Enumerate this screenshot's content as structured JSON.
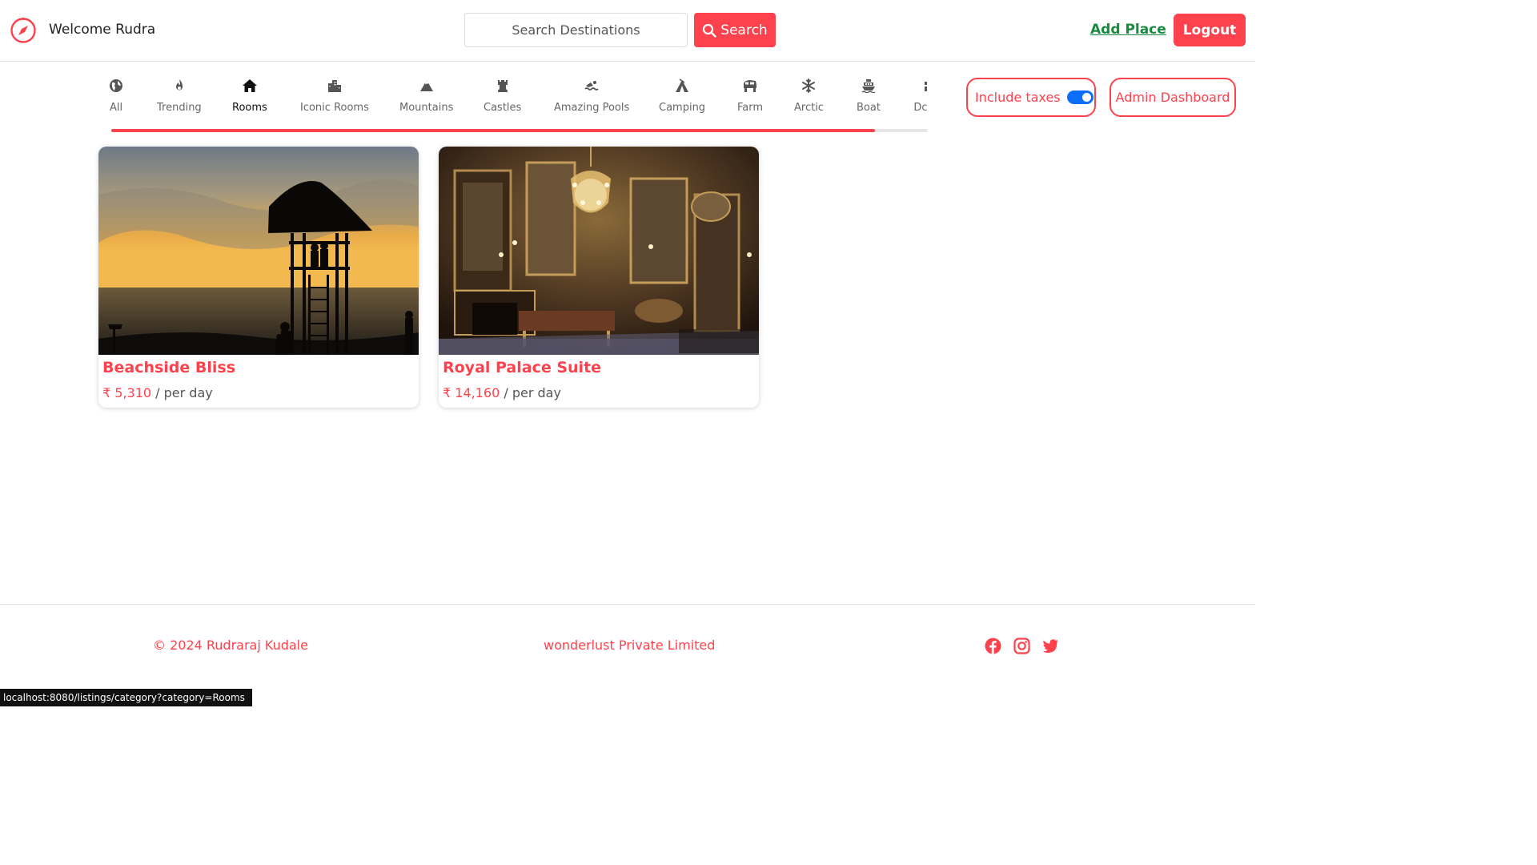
{
  "navbar": {
    "welcome": "Welcome Rudra",
    "search_placeholder": "Search Destinations",
    "search_label": "Search",
    "add_place": "Add Place",
    "logout": "Logout"
  },
  "filters": [
    {
      "label": "All",
      "icon": "globe-icon"
    },
    {
      "label": "Trending",
      "icon": "fire-icon"
    },
    {
      "label": "Rooms",
      "icon": "house-icon",
      "active": true
    },
    {
      "label": "Iconic Rooms",
      "icon": "city-icon"
    },
    {
      "label": "Mountains",
      "icon": "mountain-icon"
    },
    {
      "label": "Castles",
      "icon": "castle-icon"
    },
    {
      "label": "Amazing Pools",
      "icon": "swimmer-icon"
    },
    {
      "label": "Camping",
      "icon": "tent-icon"
    },
    {
      "label": "Farm",
      "icon": "tractor-icon"
    },
    {
      "label": "Arctic",
      "icon": "snowflake-icon"
    },
    {
      "label": "Boat",
      "icon": "ship-icon"
    },
    {
      "label": "Dc",
      "icon": "dome-icon"
    }
  ],
  "toggles": {
    "include_taxes": "Include taxes",
    "taxes_enabled": true,
    "admin_dashboard": "Admin Dashboard"
  },
  "scroll_progress": 0.935,
  "listings": [
    {
      "title": "Beachside Bliss",
      "price": "₹ 5,310",
      "unit": " / per day",
      "image": "beach-sunset-watchtower"
    },
    {
      "title": "Royal Palace Suite",
      "price": "₹ 14,160",
      "unit": " / per day",
      "image": "palace-room-chandelier"
    }
  ],
  "footer": {
    "copyright": "© 2024 Rudraraj Kudale",
    "company": "wonderlust Private Limited",
    "social": [
      "facebook-icon",
      "instagram-icon",
      "twitter-icon"
    ]
  },
  "statusbar": "localhost:8080/listings/category?category=Rooms",
  "colors": {
    "accent": "#fe424d",
    "link_green": "#1a8a3f",
    "toggle_blue": "#0d6efd"
  }
}
